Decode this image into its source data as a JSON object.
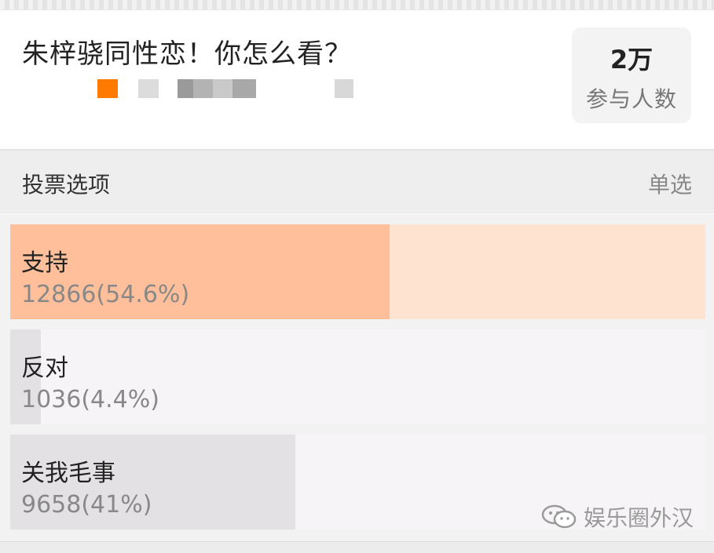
{
  "poll": {
    "title": "朱梓骁同性恋！你怎么看？",
    "participant_count": "2万",
    "participant_label": "参与人数"
  },
  "section": {
    "title": "投票选项",
    "mode": "单选"
  },
  "options": [
    {
      "label": "支持",
      "stats": "12866(54.6%)",
      "votes": 12866,
      "percent": 54.6,
      "selected": true
    },
    {
      "label": "反对",
      "stats": "1036(4.4%)",
      "votes": 1036,
      "percent": 4.4,
      "selected": false
    },
    {
      "label": "关我毛事",
      "stats": "9658(41%)",
      "votes": 9658,
      "percent": 41,
      "selected": false
    }
  ],
  "watermark": {
    "text": "娱乐圈外汉",
    "icon": "wechat-icon"
  },
  "colors": {
    "selected_fill": "#ffbf9b",
    "selected_track": "#fde3d0",
    "unselected_fill": "#e3e1e3",
    "meta_accent": "#ff7a00"
  }
}
